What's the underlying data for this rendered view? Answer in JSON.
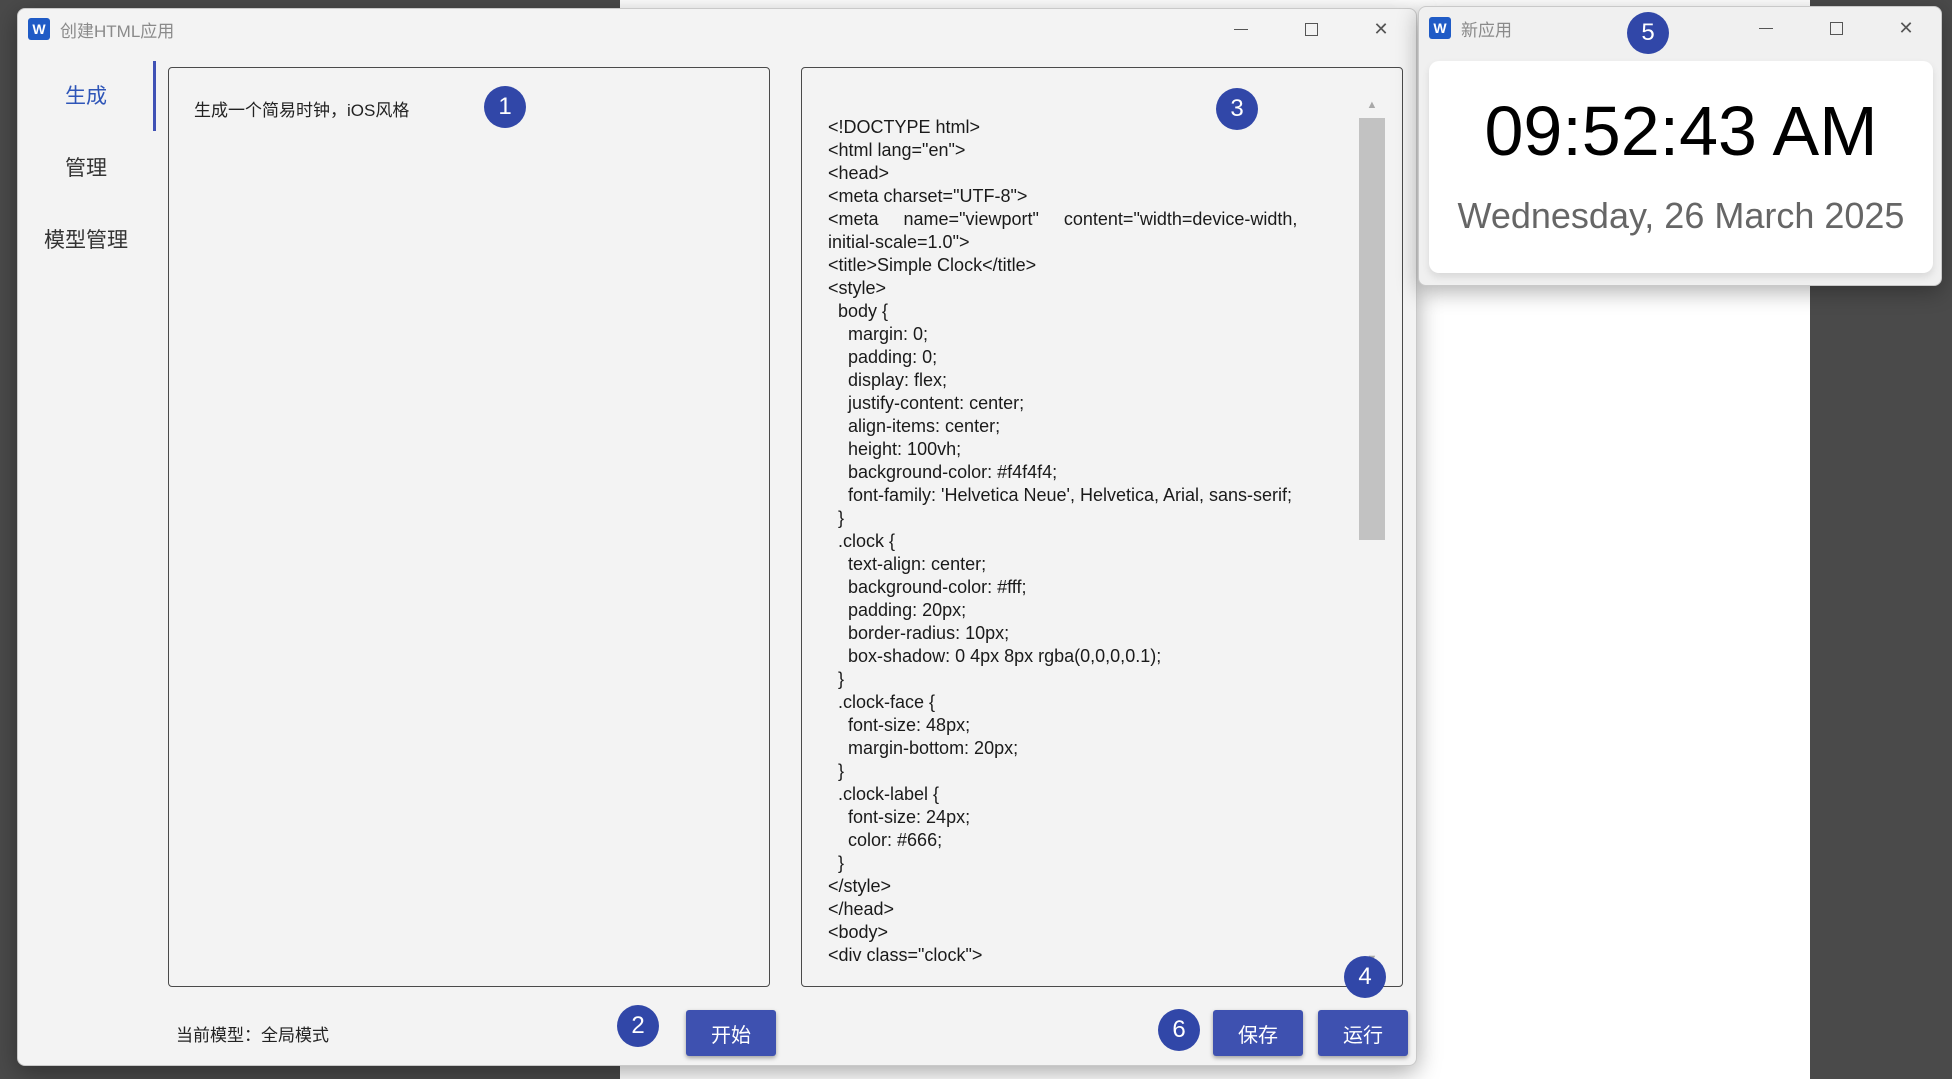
{
  "main_window": {
    "title": "创建HTML应用",
    "icon": "W",
    "sidebar": [
      {
        "label": "生成",
        "active": true
      },
      {
        "label": "管理",
        "active": false
      },
      {
        "label": "模型管理",
        "active": false
      }
    ],
    "prompt": "生成一个简易时钟，iOS风格",
    "code": "<!DOCTYPE html>\n<html lang=\"en\">\n<head>\n<meta charset=\"UTF-8\">\n<meta     name=\"viewport\"     content=\"width=device-width, initial-scale=1.0\">\n<title>Simple Clock</title>\n<style>\n  body {\n    margin: 0;\n    padding: 0;\n    display: flex;\n    justify-content: center;\n    align-items: center;\n    height: 100vh;\n    background-color: #f4f4f4;\n    font-family: 'Helvetica Neue', Helvetica, Arial, sans-serif;\n  }\n  .clock {\n    text-align: center;\n    background-color: #fff;\n    padding: 20px;\n    border-radius: 10px;\n    box-shadow: 0 4px 8px rgba(0,0,0,0.1);\n  }\n  .clock-face {\n    font-size: 48px;\n    margin-bottom: 20px;\n  }\n  .clock-label {\n    font-size: 24px;\n    color: #666;\n  }\n</style>\n</head>\n<body>\n<div class=\"clock\">",
    "model_label": "当前模型：全局模式",
    "buttons": {
      "start": "开始",
      "save": "保存",
      "run": "运行"
    }
  },
  "preview_window": {
    "title": "新应用",
    "icon": "W",
    "time": "09:52:43 AM",
    "date": "Wednesday, 26 March 2025"
  },
  "markers": [
    "1",
    "2",
    "3",
    "4",
    "5",
    "6"
  ],
  "colors": {
    "accent": "#3e51b0",
    "marker": "#3147a8",
    "window_bg": "#f3f3f3"
  }
}
